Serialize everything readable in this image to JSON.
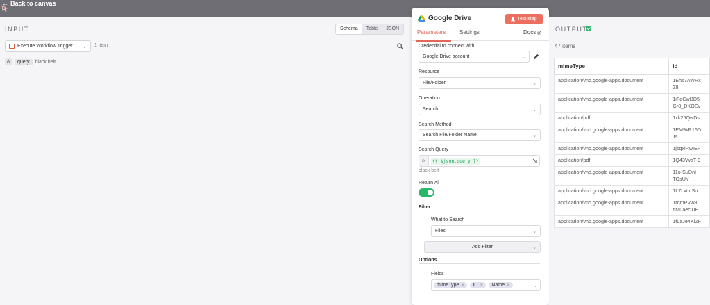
{
  "top_bar": {
    "back_label": "Back to canvas"
  },
  "input_panel": {
    "title": "INPUT",
    "view_tabs": [
      "Schema",
      "Table",
      "JSON"
    ],
    "trigger": "Execute Workflow Trigger",
    "item_count": "1 item",
    "schema": {
      "type": "A",
      "field": "query",
      "value": "black belt"
    }
  },
  "node": {
    "title": "Google Drive",
    "test_label": "Test step",
    "tabs": [
      "Parameters",
      "Settings"
    ],
    "docs_label": "Docs",
    "credential": {
      "label": "Credential to connect with",
      "value": "Google Drive account"
    },
    "resource": {
      "label": "Resource",
      "value": "File/Folder"
    },
    "operation": {
      "label": "Operation",
      "value": "Search"
    },
    "search_method": {
      "label": "Search Method",
      "value": "Search File/Folder Name"
    },
    "search_query": {
      "label": "Search Query",
      "expression": "{{ $json.query }}",
      "hint": "black belt"
    },
    "return_all": {
      "label": "Return All",
      "enabled": true
    },
    "filter": {
      "title": "Filter",
      "what_label": "What to Search",
      "what_value": "Files",
      "add_label": "Add Filter"
    },
    "options": {
      "title": "Options",
      "fields_label": "Fields",
      "chips": [
        "mimeType",
        "ID",
        "Name"
      ]
    }
  },
  "output_panel": {
    "title": "OUTPUT",
    "item_count": "47 items",
    "columns": [
      "mimeType",
      "id"
    ],
    "rows": [
      {
        "mimeType": "application/vnd.google-apps.document",
        "id": "1Ehs7AWRx\nZ8"
      },
      {
        "mimeType": "application/vnd.google-apps.document",
        "id": "1iFdCwlJD5\nGr8_DKOEv"
      },
      {
        "mimeType": "application/pdf",
        "id": "1xk25QwDs"
      },
      {
        "mimeType": "application/vnd.google-apps.document",
        "id": "1EM9kR16D\nTs"
      },
      {
        "mimeType": "application/vnd.google-apps.document",
        "id": "1jsqxlRwIEF"
      },
      {
        "mimeType": "application/pdf",
        "id": "1Q43VvsT-9"
      },
      {
        "mimeType": "application/vnd.google-apps.document",
        "id": "11o-SuDnH\nTOsUY"
      },
      {
        "mimeType": "application/vnd.google-apps.document",
        "id": "1L7LvtiuSu"
      },
      {
        "mimeType": "application/vnd.google-apps.document",
        "id": "1rqmPVw8\nttM0aeciDE"
      },
      {
        "mimeType": "application/vnd.google-apps.document",
        "id": "1fLaJe4KlZF"
      }
    ]
  },
  "colors": {
    "accent": "#ec6e5e",
    "success": "#29b869"
  }
}
